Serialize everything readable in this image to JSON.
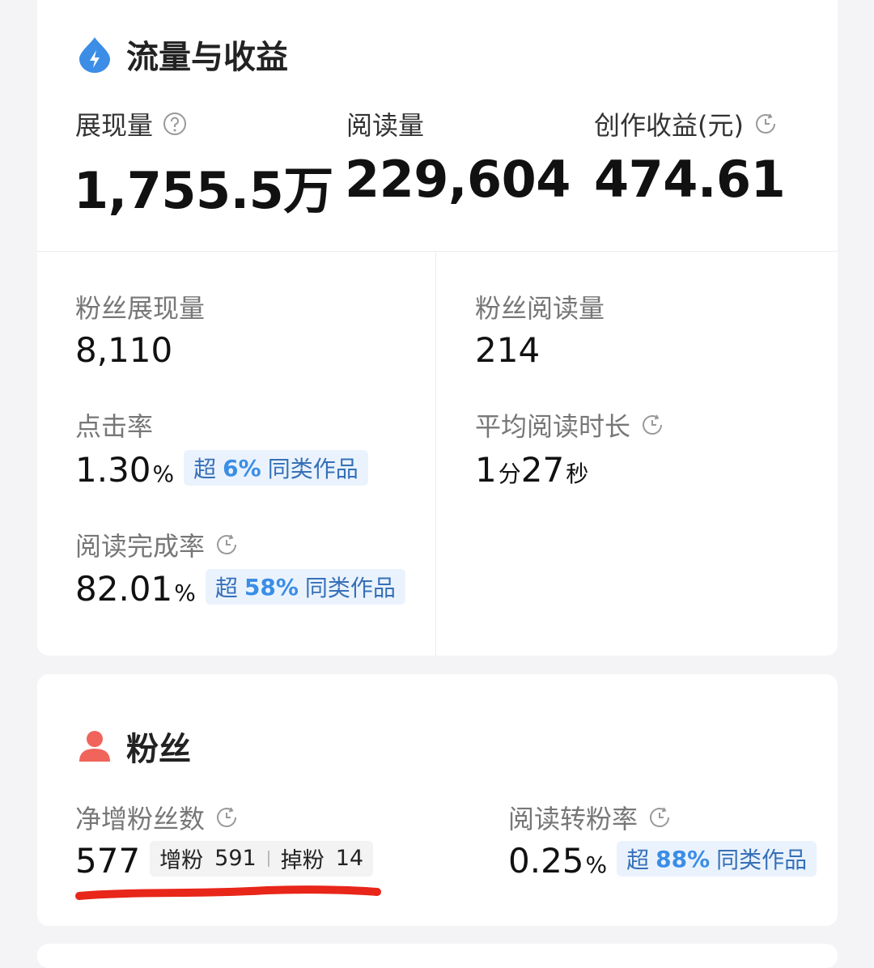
{
  "traffic": {
    "title": "流量与收益",
    "impressions": {
      "label": "展现量",
      "value": "1,755.5万"
    },
    "reads": {
      "label": "阅读量",
      "value": "229,604"
    },
    "earnings": {
      "label": "创作收益(元)",
      "value": "474.61"
    },
    "fan_impressions": {
      "label": "粉丝展现量",
      "value": "8,110"
    },
    "fan_reads": {
      "label": "粉丝阅读量",
      "value": "214"
    },
    "ctr": {
      "label": "点击率",
      "value": "1.30",
      "unit": "%",
      "badge_pre": "超",
      "badge_pct": "6%",
      "badge_post": "同类作品"
    },
    "avg_read_time": {
      "label": "平均阅读时长",
      "minutes": "1",
      "min_unit": "分",
      "seconds": "27",
      "sec_unit": "秒"
    },
    "completion": {
      "label": "阅读完成率",
      "value": "82.01",
      "unit": "%",
      "badge_pre": "超",
      "badge_pct": "58%",
      "badge_post": "同类作品"
    }
  },
  "fans": {
    "title": "粉丝",
    "net_growth": {
      "label": "净增粉丝数",
      "value": "577",
      "gain_label": "增粉",
      "gain_value": "591",
      "loss_label": "掉粉",
      "loss_value": "14"
    },
    "conversion": {
      "label": "阅读转粉率",
      "value": "0.25",
      "unit": "%",
      "badge_pre": "超",
      "badge_pct": "88%",
      "badge_post": "同类作品"
    }
  },
  "colors": {
    "accent_blue": "#3b8de6",
    "fan_red": "#f0645c",
    "underline_red": "#e8261a"
  },
  "icons": {
    "section1": "lightning-drop-icon",
    "section2": "user-icon",
    "help": "question-circle-icon",
    "history": "clock-history-icon"
  }
}
